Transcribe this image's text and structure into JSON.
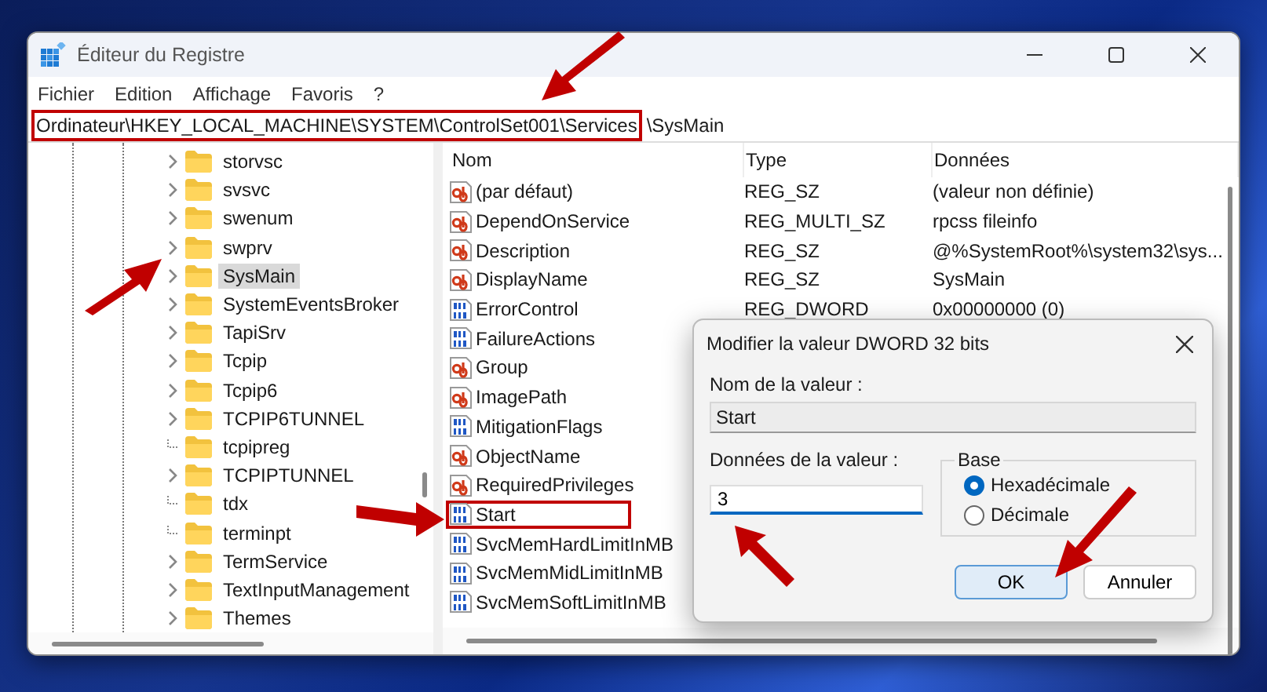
{
  "window": {
    "title": "Éditeur du Registre"
  },
  "menu": [
    "Fichier",
    "Edition",
    "Affichage",
    "Favoris",
    "?"
  ],
  "address": {
    "parts": [
      {
        "text": "Ordinateur\\HKEY_LOCAL_MACHINE\\SYSTEM\\ControlSet001\\Services",
        "highlighted": true
      },
      {
        "text": "\\SysMain",
        "highlighted": false
      }
    ]
  },
  "tree": {
    "items": [
      {
        "name": "storvsc",
        "has_children": true,
        "selected": false
      },
      {
        "name": "svsvc",
        "has_children": true,
        "selected": false
      },
      {
        "name": "swenum",
        "has_children": true,
        "selected": false
      },
      {
        "name": "swprv",
        "has_children": true,
        "selected": false
      },
      {
        "name": "SysMain",
        "has_children": true,
        "selected": true
      },
      {
        "name": "SystemEventsBroker",
        "has_children": true,
        "selected": false
      },
      {
        "name": "TapiSrv",
        "has_children": true,
        "selected": false
      },
      {
        "name": "Tcpip",
        "has_children": true,
        "selected": false
      },
      {
        "name": "Tcpip6",
        "has_children": true,
        "selected": false
      },
      {
        "name": "TCPIP6TUNNEL",
        "has_children": true,
        "selected": false
      },
      {
        "name": "tcpipreg",
        "has_children": false,
        "selected": false
      },
      {
        "name": "TCPIPTUNNEL",
        "has_children": true,
        "selected": false
      },
      {
        "name": "tdx",
        "has_children": false,
        "selected": false
      },
      {
        "name": "terminpt",
        "has_children": false,
        "selected": false
      },
      {
        "name": "TermService",
        "has_children": true,
        "selected": false
      },
      {
        "name": "TextInputManagement",
        "has_children": true,
        "selected": false
      },
      {
        "name": "Themes",
        "has_children": true,
        "selected": false
      }
    ]
  },
  "values": {
    "columns": [
      "Nom",
      "Type",
      "Données"
    ],
    "rows": [
      {
        "kind": "string",
        "name": "(par défaut)",
        "type": "REG_SZ",
        "data": "(valeur non définie)",
        "highlighted": false
      },
      {
        "kind": "string",
        "name": "DependOnService",
        "type": "REG_MULTI_SZ",
        "data": "rpcss fileinfo",
        "highlighted": false
      },
      {
        "kind": "string",
        "name": "Description",
        "type": "REG_SZ",
        "data": "@%SystemRoot%\\system32\\sys...",
        "highlighted": false
      },
      {
        "kind": "string",
        "name": "DisplayName",
        "type": "REG_SZ",
        "data": "SysMain",
        "highlighted": false
      },
      {
        "kind": "binary",
        "name": "ErrorControl",
        "type": "REG_DWORD",
        "data": "0x00000000 (0)",
        "highlighted": false
      },
      {
        "kind": "binary",
        "name": "FailureActions",
        "highlighted": false
      },
      {
        "kind": "string",
        "name": "Group",
        "highlighted": false
      },
      {
        "kind": "string",
        "name": "ImagePath",
        "highlighted": false
      },
      {
        "kind": "binary",
        "name": "MitigationFlags",
        "highlighted": false
      },
      {
        "kind": "string",
        "name": "ObjectName",
        "highlighted": false
      },
      {
        "kind": "string",
        "name": "RequiredPrivileges",
        "highlighted": false
      },
      {
        "kind": "binary",
        "name": "Start",
        "highlighted": true
      },
      {
        "kind": "binary",
        "name": "SvcMemHardLimitInMB",
        "highlighted": false
      },
      {
        "kind": "binary",
        "name": "SvcMemMidLimitInMB",
        "highlighted": false
      },
      {
        "kind": "binary",
        "name": "SvcMemSoftLimitInMB",
        "highlighted": false
      }
    ]
  },
  "dialog": {
    "title": "Modifier la valeur DWORD 32 bits",
    "name_label": "Nom de la valeur :",
    "name_value": "Start",
    "data_label": "Données de la valeur :",
    "data_value": "3",
    "base_label": "Base",
    "bases": [
      {
        "label": "Hexadécimale",
        "selected": true
      },
      {
        "label": "Décimale",
        "selected": false
      }
    ],
    "buttons": [
      {
        "label": "OK",
        "default": true
      },
      {
        "label": "Annuler",
        "default": false
      }
    ]
  }
}
